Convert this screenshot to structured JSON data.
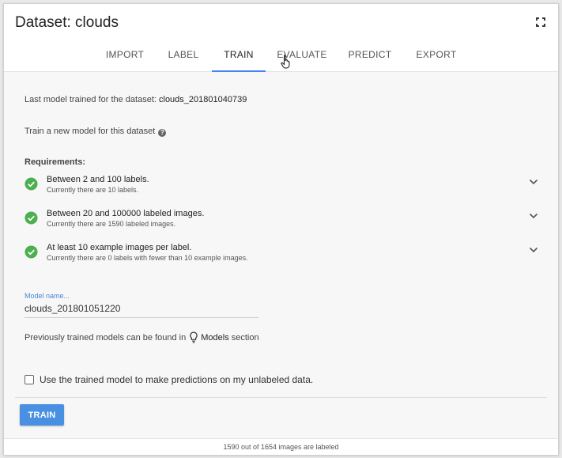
{
  "title": "Dataset: clouds",
  "tabs": [
    {
      "label": "IMPORT"
    },
    {
      "label": "LABEL"
    },
    {
      "label": "TRAIN"
    },
    {
      "label": "EVALUATE"
    },
    {
      "label": "PREDICT"
    },
    {
      "label": "EXPORT"
    }
  ],
  "active_tab": "TRAIN",
  "last_model": {
    "prefix": "Last model trained for the dataset: ",
    "name": "clouds_201801040739"
  },
  "train_new": "Train a new model for this dataset",
  "requirements": {
    "title": "Requirements:",
    "items": [
      {
        "main": "Between 2 and 100 labels.",
        "sub": "Currently there are 10 labels."
      },
      {
        "main": "Between 20 and 100000 labeled images.",
        "sub": "Currently there are 1590 labeled images."
      },
      {
        "main": "At least 10 example images per label.",
        "sub": "Currently there are 0 labels with fewer than 10 example images."
      }
    ]
  },
  "model_name": {
    "label": "Model name...",
    "value": "clouds_201801051220"
  },
  "previous": {
    "prefix": "Previously trained models can be found in",
    "link": "Models",
    "suffix": " section"
  },
  "checkbox_label": "Use the trained model to make predictions on my unlabeled data.",
  "train_button": "TRAIN",
  "footer": "1590 out of 1654 images are labeled",
  "colors": {
    "accent": "#4285f4",
    "check": "#4caf50",
    "button": "#4a90e2"
  }
}
